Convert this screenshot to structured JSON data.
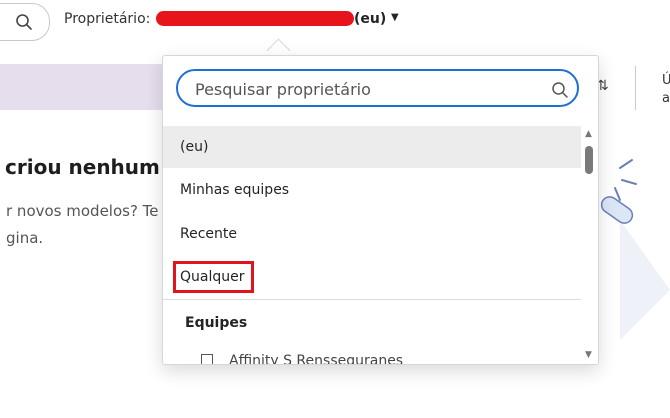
{
  "toolbar": {
    "owner_label": "Proprietário:",
    "owner_value": "(eu)"
  },
  "content": {
    "empty_title": "criou nenhum",
    "empty_line1": "r novos modelos? Te",
    "empty_line2": "gina."
  },
  "owner_dropdown": {
    "search_placeholder": "Pesquisar proprietário",
    "options": [
      "(eu)",
      "Minhas equipes",
      "Recente",
      "Qualquer"
    ],
    "selected": "(eu)",
    "group_header": "Equipes",
    "group_items": [
      "Affinity S Rensseguranes"
    ]
  },
  "header_right": {
    "glyph_top": "Ú",
    "glyph_bottom": "a"
  },
  "colors": {
    "accent_blue": "#1e6fd9",
    "banner_lavender": "#e7deed",
    "highlight_red": "#e0141b"
  }
}
